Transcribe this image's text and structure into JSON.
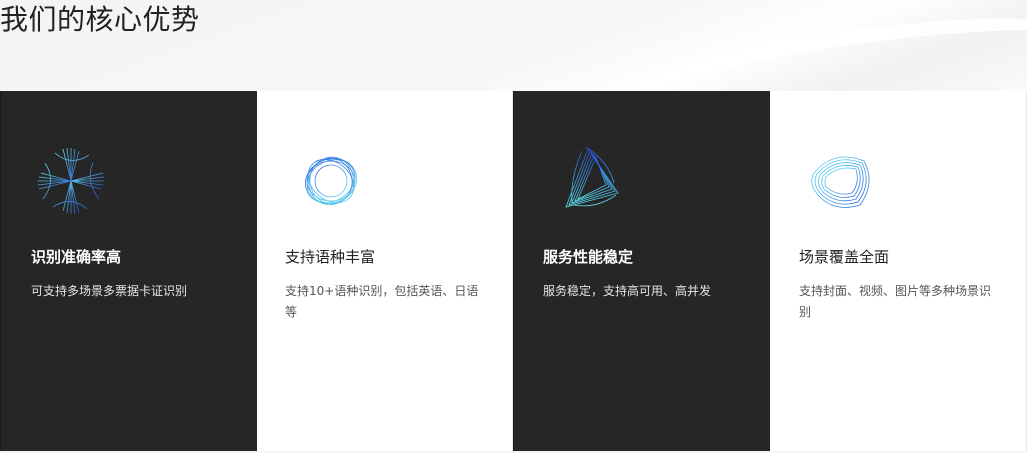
{
  "section": {
    "title": "我们的核心优势"
  },
  "cards": [
    {
      "title": "识别准确率高",
      "description": "可支持多场景多票据卡证识别",
      "theme": "dark",
      "icon": "accuracy-swirl-icon"
    },
    {
      "title": "支持语种丰富",
      "description": "支持10+语种识别，包括英语、日语等",
      "theme": "light",
      "icon": "language-ring-icon"
    },
    {
      "title": "服务性能稳定",
      "description": "服务稳定，支持高可用、高并发",
      "theme": "dark",
      "icon": "stability-triangle-icon"
    },
    {
      "title": "场景覆盖全面",
      "description": "支持封面、视频、图片等多种场景识别",
      "theme": "light",
      "icon": "coverage-ring-icon"
    }
  ],
  "colors": {
    "dark_card": "#262626",
    "light_card": "#ffffff",
    "icon_cyan": "#3fd6e6",
    "icon_blue": "#2a5fe0"
  }
}
